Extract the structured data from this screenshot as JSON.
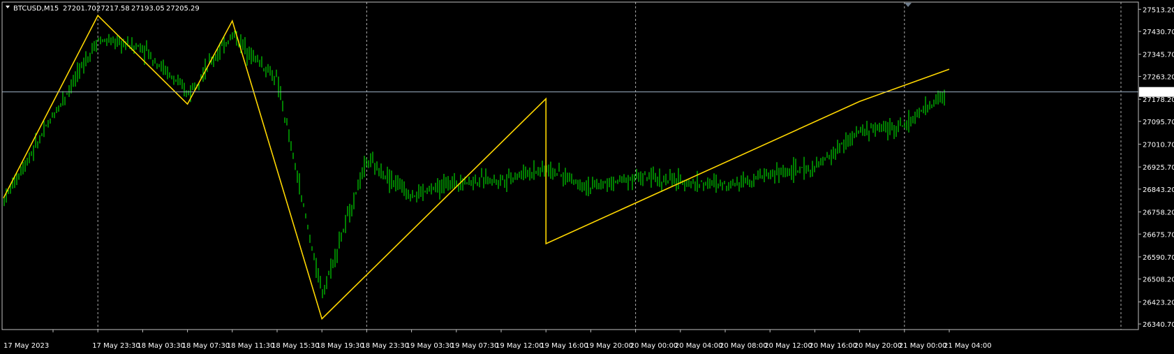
{
  "header": {
    "symbol": "BTCUSD,M15",
    "open": "27201.70",
    "high": "27217.58",
    "low": "27193.05",
    "close": "27205.29"
  },
  "current_price": {
    "value": 27205.29,
    "label": "27205.29"
  },
  "colors": {
    "background": "#000000",
    "frame": "#c0c0c0",
    "grid": "#c0c0c0",
    "candle": "#00ff00",
    "zigzag": "#ffd700",
    "price_line": "#a0b4c8",
    "text": "#ffffff"
  },
  "chart_data": {
    "type": "line",
    "title": "BTCUSD,M15",
    "ylim": [
      26320,
      27540
    ],
    "y_ticks": [
      "27513.20",
      "27430.70",
      "27345.70",
      "27263.20",
      "27178.20",
      "27095.70",
      "27010.70",
      "26925.70",
      "26843.20",
      "26758.20",
      "26675.70",
      "26590.70",
      "26508.20",
      "26423.20",
      "26340.70"
    ],
    "x_tick_labels": [
      "17 May 2023",
      "17 May 23:30",
      "18 May 03:30",
      "18 May 07:30",
      "18 May 11:30",
      "18 May 15:30",
      "18 May 19:30",
      "18 May 23:30",
      "19 May 03:30",
      "19 May 07:30",
      "19 May 12:00",
      "19 May 16:00",
      "19 May 20:00",
      "20 May 00:00",
      "20 May 04:00",
      "20 May 08:00",
      "20 May 12:00",
      "20 May 16:00",
      "20 May 20:00",
      "21 May 00:00",
      "21 May 04:00"
    ],
    "vertical_grid_at": [
      "17 May 23:30",
      "18 May 23:30",
      "20 May 00:00",
      "21 May 00:00"
    ],
    "zigzag": {
      "x": [
        "17 May 19:30",
        "17 May 23:30",
        "18 May 07:30",
        "18 May 11:30",
        "18 May 19:30",
        "19 May 16:00",
        "19 May 16:00",
        "20 May 20:00",
        "21 May 04:00"
      ],
      "y": [
        26810,
        27490,
        27160,
        27470,
        26360,
        27180,
        26640,
        27170,
        27290
      ]
    },
    "price_path": {
      "x": [
        "17 May 19:30",
        "17 May 23:30",
        "18 May 03:30",
        "18 May 07:30",
        "18 May 11:30",
        "18 May 15:30",
        "18 May 19:30",
        "18 May 23:30",
        "19 May 03:30",
        "19 May 07:30",
        "19 May 12:00",
        "19 May 16:00",
        "19 May 20:00",
        "20 May 00:00",
        "20 May 04:00",
        "20 May 08:00",
        "20 May 12:00",
        "20 May 16:00",
        "20 May 20:00",
        "21 May 00:00",
        "21 May 04:00"
      ],
      "y": [
        26800,
        27400,
        27370,
        27200,
        27420,
        27250,
        26450,
        26950,
        26820,
        26870,
        26880,
        26920,
        26850,
        26890,
        26870,
        26860,
        26900,
        26920,
        27060,
        27080,
        27210
      ]
    }
  }
}
